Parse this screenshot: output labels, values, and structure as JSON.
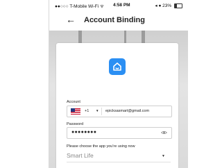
{
  "status_bar": {
    "carrier": "●●○○○ T-Mobile Wi-Fi ᯤ",
    "time": "4:58 PM",
    "right": "◂ ● 23%"
  },
  "nav": {
    "back_icon": "back-arrow-icon",
    "title": "Account Binding"
  },
  "logo": {
    "icon": "smart-home-icon",
    "bg_color": "#2b8ff3"
  },
  "form": {
    "account_label": "Account",
    "country_flag_icon": "us-flag-icon",
    "country_code": "+1",
    "account_value": "epicksasmart@gmail.com",
    "password_label": "Password",
    "password_value": "●●●●●●●●",
    "eye_icon": "eye-icon",
    "app_prompt": "Please choose the app you're using now",
    "app_selected": "Smart Life"
  }
}
